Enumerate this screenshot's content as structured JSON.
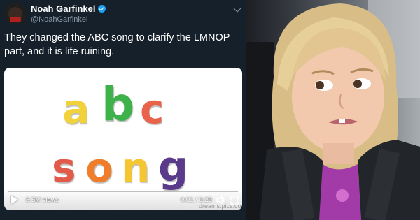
{
  "tweet": {
    "name": "Noah Garfinkel",
    "handle": "@NoahGarfinkel",
    "text": "They changed the ABC song to clarify the LMNOP part, and it is life ruining.",
    "video": {
      "title_line1": [
        "a",
        "b",
        "c"
      ],
      "title_line2": [
        "s",
        "o",
        "n",
        "g"
      ],
      "views": "8.5M views",
      "time": "0:01 / 0:29",
      "watermark": "dreams.pics.com"
    }
  },
  "colors": {
    "tweet_bg": "#15202b",
    "verified": "#1da1f2",
    "letter_a": "#f1d23a",
    "letter_b": "#3db14a",
    "letter_c": "#e8634a",
    "letter_s": "#e15a4a",
    "letter_o": "#f07d2a",
    "letter_n": "#f4c632",
    "letter_g": "#5a3a8a"
  },
  "icons": [
    "verified-badge-icon",
    "chevron-down-icon",
    "play-icon",
    "volume-icon",
    "fullscreen-icon"
  ]
}
